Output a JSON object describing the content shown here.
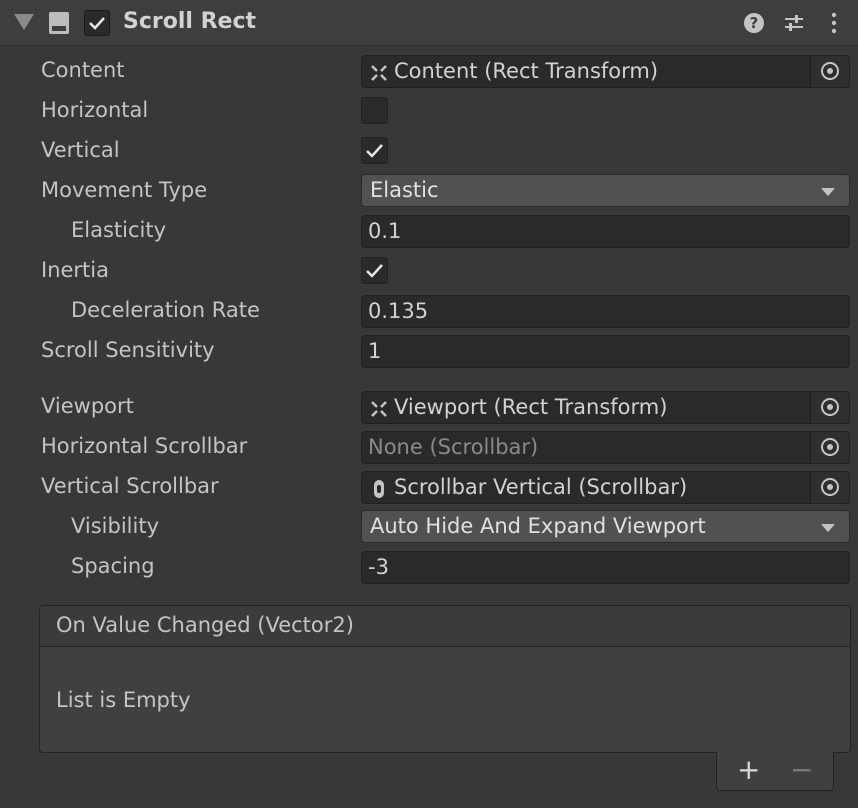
{
  "component": {
    "title": "Scroll Rect",
    "enabled": true,
    "icons": [
      "foldout-arrow-icon",
      "component-icon",
      "help-icon",
      "presets-icon",
      "kebab-menu-icon"
    ]
  },
  "fields": {
    "content": {
      "label": "Content",
      "value": "Content (Rect Transform)"
    },
    "horizontal": {
      "label": "Horizontal",
      "checked": false
    },
    "vertical": {
      "label": "Vertical",
      "checked": true
    },
    "movement_type": {
      "label": "Movement Type",
      "value": "Elastic"
    },
    "elasticity": {
      "label": "Elasticity",
      "value": "0.1"
    },
    "inertia": {
      "label": "Inertia",
      "checked": true
    },
    "deceleration_rate": {
      "label": "Deceleration Rate",
      "value": "0.135"
    },
    "scroll_sensitivity": {
      "label": "Scroll Sensitivity",
      "value": "1"
    },
    "viewport": {
      "label": "Viewport",
      "value": "Viewport (Rect Transform)"
    },
    "horizontal_scrollbar": {
      "label": "Horizontal Scrollbar",
      "value": "None (Scrollbar)"
    },
    "vertical_scrollbar": {
      "label": "Vertical Scrollbar",
      "value": "Scrollbar Vertical (Scrollbar)"
    },
    "visibility": {
      "label": "Visibility",
      "value": "Auto Hide And Expand Viewport"
    },
    "spacing": {
      "label": "Spacing",
      "value": "-3"
    }
  },
  "event": {
    "title": "On Value Changed (Vector2)",
    "empty_text": "List is Empty",
    "add_label": "+",
    "remove_label": "−"
  }
}
